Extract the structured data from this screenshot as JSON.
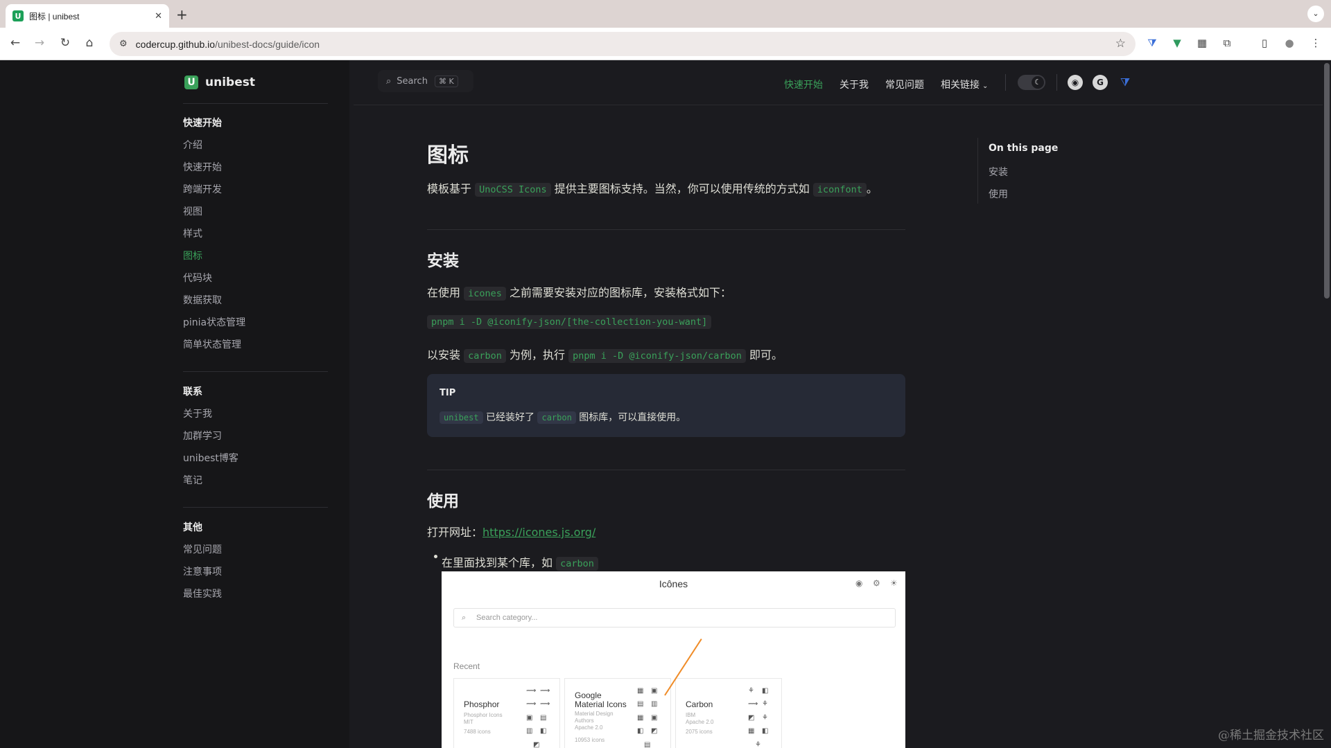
{
  "browser": {
    "tab_title": "图标 | unibest",
    "favicon_letter": "U",
    "close_glyph": "✕",
    "new_tab_glyph": "+",
    "tab_dropdown_glyph": "⌄",
    "url_host": "codercup.github.io",
    "url_path": "/unibest-docs/guide/icon",
    "nav": {
      "back": "←",
      "forward": "→",
      "reload": "↻",
      "home": "⌂"
    },
    "star_glyph": "☆",
    "extensions": [
      "⧩",
      "▼",
      "▦",
      "⧉",
      "▯",
      "●",
      "⋮"
    ]
  },
  "site": {
    "logo_letter": "U",
    "name": "unibest",
    "search_label": "Search",
    "search_kbd": "⌘ K",
    "topnav": [
      {
        "label": "快速开始",
        "active": true
      },
      {
        "label": "关于我",
        "active": false
      },
      {
        "label": "常见问题",
        "active": false
      },
      {
        "label": "相关链接",
        "active": false
      }
    ],
    "caret": "⌄",
    "theme_glyph": "☾",
    "social": [
      "◉",
      "G",
      "⧩"
    ]
  },
  "sidebar": {
    "groups": [
      {
        "title": "快速开始",
        "items": [
          {
            "label": "介绍",
            "active": false
          },
          {
            "label": "快速开始",
            "active": false
          },
          {
            "label": "跨端开发",
            "active": false
          },
          {
            "label": "视图",
            "active": false
          },
          {
            "label": "样式",
            "active": false
          },
          {
            "label": "图标",
            "active": true
          },
          {
            "label": "代码块",
            "active": false
          },
          {
            "label": "数据获取",
            "active": false
          },
          {
            "label": "pinia状态管理",
            "active": false
          },
          {
            "label": "简单状态管理",
            "active": false
          }
        ]
      },
      {
        "title": "联系",
        "items": [
          {
            "label": "关于我",
            "active": false
          },
          {
            "label": "加群学习",
            "active": false
          },
          {
            "label": "unibest博客",
            "active": false
          },
          {
            "label": "笔记",
            "active": false
          }
        ]
      },
      {
        "title": "其他",
        "items": [
          {
            "label": "常见问题",
            "active": false
          },
          {
            "label": "注意事项",
            "active": false
          },
          {
            "label": "最佳实践",
            "active": false
          }
        ]
      }
    ]
  },
  "content": {
    "title": "图标",
    "intro": {
      "t1": "模板基于 ",
      "c1": "UnoCSS Icons",
      "t2": " 提供主要图标支持。当然，你可以使用传统的方式如 ",
      "c2": "iconfont",
      "t3": "。"
    },
    "install_heading": "安装",
    "install_p1": {
      "t1": "在使用 ",
      "c1": "icones",
      "t2": " 之前需要安装对应的图标库，安装格式如下："
    },
    "install_cmd": "pnpm i -D @iconify-json/[the-collection-you-want]",
    "install_p2": {
      "t1": "以安装 ",
      "c1": "carbon",
      "t2": " 为例，执行 ",
      "c2": "pnpm i -D @iconify-json/carbon",
      "t3": " 即可。"
    },
    "tip": {
      "title": "TIP",
      "c1": "unibest",
      "t1": " 已经装好了 ",
      "c2": "carbon",
      "t2": " 图标库，可以直接使用。"
    },
    "use_heading": "使用",
    "use_p1": {
      "t1": "打开网址：",
      "link": "https://icones.js.org/"
    },
    "use_bullet": {
      "t1": "在里面找到某个库，如 ",
      "c1": "carbon"
    }
  },
  "embedded_shot": {
    "title": "Icônes",
    "search_placeholder": "Search category...",
    "recent_label": "Recent",
    "cards": [
      {
        "name": "Phosphor",
        "meta": [
          "Phosphor Icons",
          "MIT",
          "7488 icons"
        ]
      },
      {
        "name": "Google\nMaterial Icons",
        "meta": [
          "Material Design",
          "Authors",
          "Apache 2.0",
          "10953 icons"
        ]
      },
      {
        "name": "Carbon",
        "meta": [
          "IBM",
          "Apache 2.0",
          "2075 icons"
        ]
      }
    ],
    "icon_glyphs": [
      "⟿",
      "⚘",
      "▣",
      "▤",
      "▥",
      "◧",
      "◩",
      "▦"
    ],
    "header_icons": [
      "◉",
      "⚙",
      "☀"
    ],
    "arrow_color": "#f08c28"
  },
  "aside": {
    "title": "On this page",
    "items": [
      "安装",
      "使用"
    ]
  },
  "watermark": "@稀土掘金技术社区",
  "colors": {
    "accent": "#3aa15a",
    "bg": "#1b1b1f",
    "sidebar_bg": "#161618",
    "tip_bg": "#262a36"
  }
}
